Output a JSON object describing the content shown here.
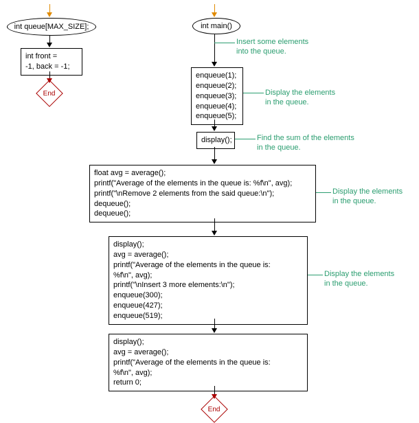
{
  "left": {
    "terminal": "int queue[MAX_SIZE];",
    "process": "int front =\n-1, back = -1;",
    "end": "End"
  },
  "right": {
    "terminal": "int main()",
    "comments": {
      "insert": "Insert some elements\ninto the queue.",
      "display1": "Display the elements\nin the queue.",
      "sum": "Find the sum of the elements\nin the queue.",
      "display2": "Display the elements\nin the queue.",
      "display3": "Display the elements\nin the queue."
    },
    "blocks": {
      "enqueue": "enqueue(1);\nenqueue(2);\nenqueue(3);\nenqueue(4);\nenqueue(5);",
      "displayCall": "display();",
      "avg1": "float avg = average();\nprintf(\"Average of the elements in the queue is: %f\\n\", avg);\nprintf(\"\\nRemove 2 elements from the said queue:\\n\");\ndequeue();\ndequeue();",
      "avg2": "display();\navg = average();\nprintf(\"Average of the elements in the queue is:\n%f\\n\", avg);\nprintf(\"\\nInsert 3 more elements:\\n\");\nenqueue(300);\nenqueue(427);\nenqueue(519);",
      "avg3": "display();\navg = average();\nprintf(\"Average of the elements in the queue is:\n%f\\n\", avg);\nreturn 0;"
    },
    "end": "End"
  }
}
